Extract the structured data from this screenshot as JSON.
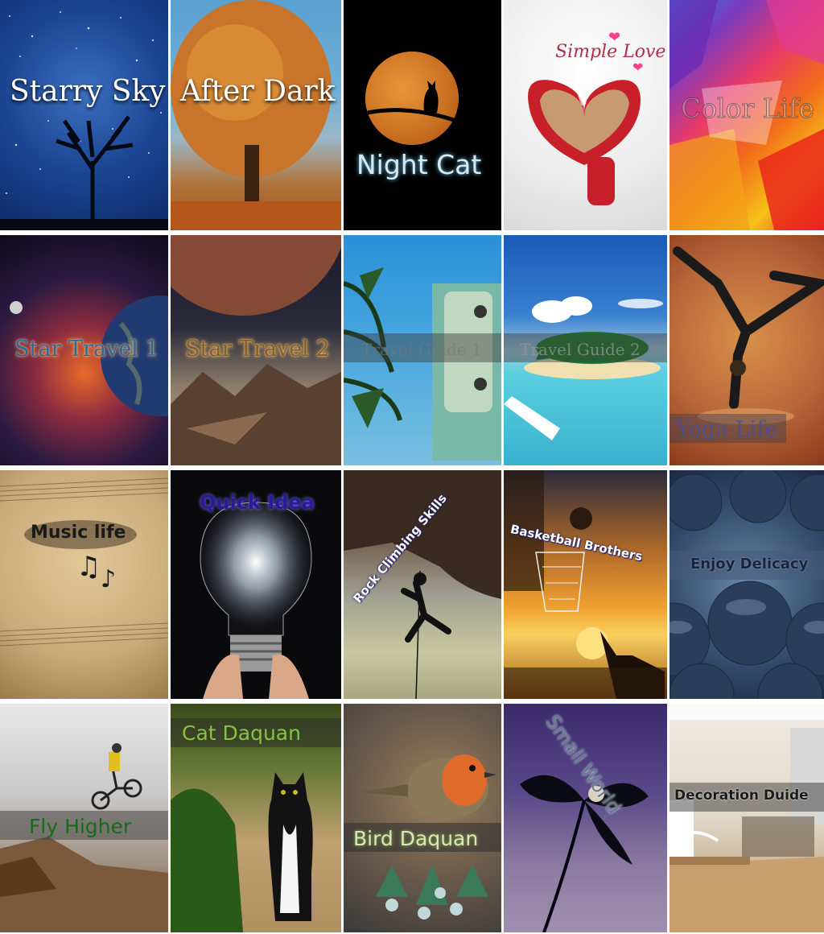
{
  "tiles": [
    {
      "title": "Starry Sky"
    },
    {
      "title": "After Dark"
    },
    {
      "title": "Night Cat"
    },
    {
      "title": "Simple Love"
    },
    {
      "title": "Color Life"
    },
    {
      "title": "Star Travel 1"
    },
    {
      "title": "Star Travel 2"
    },
    {
      "title": "Travel Guide 1"
    },
    {
      "title": "Travel Guide 2"
    },
    {
      "title": "Yoga Life"
    },
    {
      "title": "Music life"
    },
    {
      "title": "Quick Idea"
    },
    {
      "title": "Rock Climbing Skills"
    },
    {
      "title": "Basketball Brothers"
    },
    {
      "title": "Enjoy Delicacy"
    },
    {
      "title": "Fly Higher"
    },
    {
      "title": "Cat Daquan"
    },
    {
      "title": "Bird Daquan"
    },
    {
      "title": "Small World"
    },
    {
      "title": "Decoration Duide"
    }
  ],
  "colors": {
    "starry_sky": "#1f4d92",
    "after_dark": "#c8742a",
    "night_cat": "#000000",
    "simple_love": "#f2f2f2",
    "color_life": "#e84a2c",
    "star_travel": "#1a1226",
    "travel": "#1d8fd6",
    "yoga": "#b8673a",
    "music": "#c9aa7a",
    "basketball": "#e08a2a",
    "blueberry": "#334a6a"
  }
}
